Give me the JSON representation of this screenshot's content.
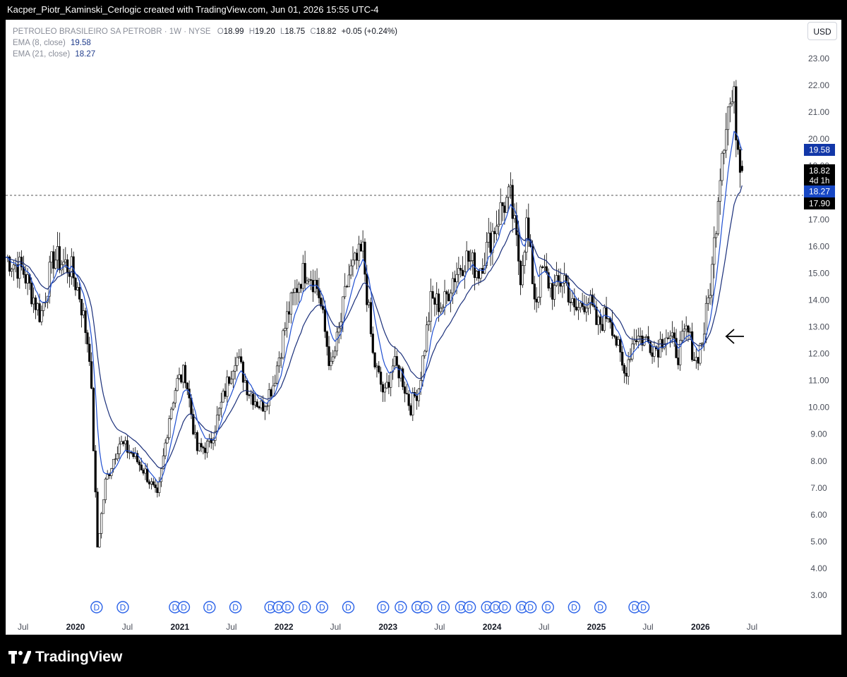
{
  "header": {
    "attribution": "Kacper_Piotr_Kaminski_Cerlogic created with TradingView.com, Jun 01, 2026 15:55 UTC-4"
  },
  "legend": {
    "symbol": "PETROLEO BRASILEIRO SA PETROBR · 1W · NYSE",
    "o_label": "O",
    "o": "18.99",
    "h_label": "H",
    "h": "19.20",
    "l_label": "L",
    "l": "18.75",
    "c_label": "C",
    "c": "18.82",
    "change": "+0.05 (+0.24%)",
    "ema8_label": "EMA (8, close)",
    "ema8_value": "19.58",
    "ema21_label": "EMA (21, close)",
    "ema21_value": "18.27"
  },
  "currency": "USD",
  "footer": {
    "brand": "TradingView",
    "logo_icon": "tradingview-logo-icon"
  },
  "price_labels": {
    "ema8": "19.58",
    "last": "18.82",
    "countdown": "4d 1h",
    "ema21": "18.27",
    "crosshair": "17.90"
  },
  "colors": {
    "up_candle": "#ffffff",
    "down_candle": "#000000",
    "ema8": "#1f4fd1",
    "ema21": "#1a2f7a",
    "ema8_label_bg": "#1237a8",
    "ema21_label_bg": "#1747c4",
    "dividend": "#2a62e8"
  },
  "chart_data": {
    "type": "candlestick",
    "timeframe": "1W",
    "x_ticks": [
      "Jul",
      "2020",
      "Jul",
      "2021",
      "Jul",
      "2022",
      "Jul",
      "2023",
      "Jul",
      "2024",
      "Jul",
      "2025",
      "Jul",
      "2026",
      "Jul"
    ],
    "y_ticks": [
      "23.00",
      "22.00",
      "21.00",
      "20.00",
      "19.00",
      "18.00",
      "17.00",
      "16.00",
      "15.00",
      "14.00",
      "13.00",
      "12.00",
      "11.00",
      "10.00",
      "9.00",
      "8.00",
      "7.00",
      "6.00",
      "5.00",
      "4.00",
      "3.00"
    ],
    "ylim": [
      2.4,
      24.1
    ],
    "x_range": [
      "2019-05",
      "2026-08"
    ],
    "price_path": [
      [
        "2019-05-01",
        15.6
      ],
      [
        "2019-07-01",
        15.1
      ],
      [
        "2019-09-01",
        13.4
      ],
      [
        "2019-10-15",
        15.6
      ],
      [
        "2019-12-15",
        15.2
      ],
      [
        "2020-01-15",
        14.2
      ],
      [
        "2020-02-20",
        12.0
      ],
      [
        "2020-03-18",
        4.8
      ],
      [
        "2020-04-15",
        7.2
      ],
      [
        "2020-06-01",
        8.7
      ],
      [
        "2020-07-15",
        8.3
      ],
      [
        "2020-09-01",
        7.6
      ],
      [
        "2020-10-15",
        6.6
      ],
      [
        "2020-11-25",
        9.7
      ],
      [
        "2020-12-20",
        10.9
      ],
      [
        "2021-01-20",
        11.3
      ],
      [
        "2021-03-01",
        8.4
      ],
      [
        "2021-04-15",
        8.6
      ],
      [
        "2021-06-01",
        10.3
      ],
      [
        "2021-07-15",
        12.0
      ],
      [
        "2021-09-01",
        10.6
      ],
      [
        "2021-10-15",
        10.0
      ],
      [
        "2021-11-25",
        10.9
      ],
      [
        "2022-01-15",
        13.5
      ],
      [
        "2022-02-25",
        14.8
      ],
      [
        "2022-03-25",
        15.2
      ],
      [
        "2022-05-01",
        14.4
      ],
      [
        "2022-06-15",
        11.4
      ],
      [
        "2022-07-15",
        12.9
      ],
      [
        "2022-08-15",
        14.9
      ],
      [
        "2022-10-05",
        15.8
      ],
      [
        "2022-11-10",
        11.8
      ],
      [
        "2022-12-20",
        10.4
      ],
      [
        "2023-01-15",
        11.6
      ],
      [
        "2023-02-15",
        11.3
      ],
      [
        "2023-03-20",
        10.0
      ],
      [
        "2023-04-20",
        10.8
      ],
      [
        "2023-06-01",
        14.0
      ],
      [
        "2023-07-15",
        13.8
      ],
      [
        "2023-08-15",
        14.8
      ],
      [
        "2023-10-01",
        15.6
      ],
      [
        "2023-11-15",
        15.1
      ],
      [
        "2023-12-20",
        16.1
      ],
      [
        "2024-02-05",
        17.5
      ],
      [
        "2024-03-05",
        17.8
      ],
      [
        "2024-04-10",
        15.0
      ],
      [
        "2024-05-01",
        16.8
      ],
      [
        "2024-06-01",
        13.9
      ],
      [
        "2024-06-25",
        15.1
      ],
      [
        "2024-08-05",
        14.3
      ],
      [
        "2024-09-10",
        14.9
      ],
      [
        "2024-10-15",
        13.5
      ],
      [
        "2024-12-01",
        14.1
      ],
      [
        "2025-01-05",
        13.0
      ],
      [
        "2025-02-15",
        13.6
      ],
      [
        "2025-04-08",
        11.2
      ],
      [
        "2025-05-15",
        12.7
      ],
      [
        "2025-06-25",
        12.5
      ],
      [
        "2025-08-01",
        12.2
      ],
      [
        "2025-09-01",
        12.8
      ],
      [
        "2025-10-15",
        12.0
      ],
      [
        "2025-11-15",
        12.9
      ],
      [
        "2025-12-15",
        11.7
      ],
      [
        "2026-01-10",
        12.6
      ],
      [
        "2026-02-10",
        15.0
      ],
      [
        "2026-03-15",
        19.5
      ],
      [
        "2026-04-08",
        21.2
      ],
      [
        "2026-04-28",
        21.4
      ],
      [
        "2026-05-15",
        19.6
      ],
      [
        "2026-05-29",
        18.82
      ]
    ],
    "last": {
      "open": 18.99,
      "high": 19.2,
      "low": 18.75,
      "close": 18.82
    },
    "series": [
      {
        "name": "EMA (8, close)",
        "last": 19.58
      },
      {
        "name": "EMA (21, close)",
        "last": 18.27
      }
    ],
    "horizontal_line": 17.9,
    "dividend_markers": [
      "2020-03",
      "2020-06",
      "2020-12",
      "2021-01",
      "2021-04",
      "2021-07",
      "2021-11",
      "2021-12",
      "2022-01",
      "2022-03",
      "2022-05",
      "2022-08",
      "2022-12",
      "2023-02",
      "2023-04",
      "2023-04",
      "2023-05",
      "2023-07",
      "2023-09",
      "2023-10",
      "2023-12",
      "2024-01",
      "2024-02",
      "2024-04",
      "2024-05",
      "2024-07",
      "2024-10",
      "2025-01",
      "2025-05",
      "2025-06"
    ],
    "annotation": "arrow pointing left at the late-2025 breakout"
  }
}
